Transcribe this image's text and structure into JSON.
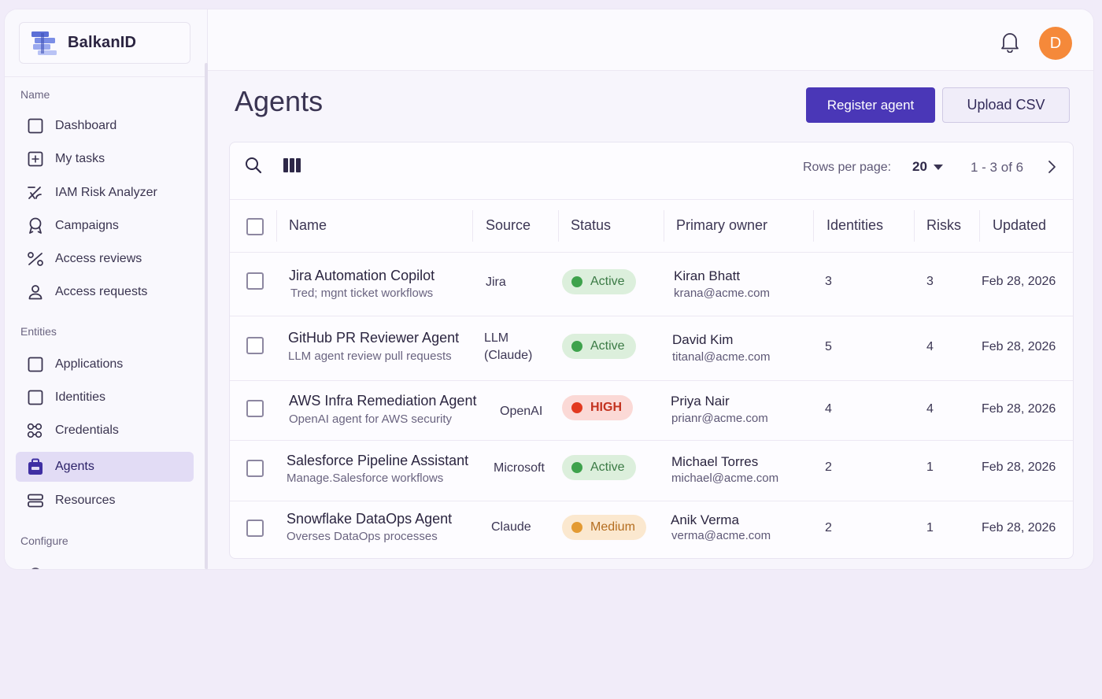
{
  "brand": {
    "name": "BalkanID"
  },
  "sidebar": {
    "section_name": "Name",
    "section_entities": "Entities",
    "section_configure": "Configure",
    "items": [
      {
        "label": "Dashboard",
        "icon": "square-icon"
      },
      {
        "label": "My tasks",
        "icon": "task-plus-icon"
      },
      {
        "label": "IAM Risk Analyzer",
        "icon": "risk-analyzer-icon"
      },
      {
        "label": "Campaigns",
        "icon": "campaign-ribbon-icon"
      },
      {
        "label": "Access reviews",
        "icon": "access-review-icon"
      },
      {
        "label": "Access requests",
        "icon": "user-icon"
      },
      {
        "label": "Applications",
        "icon": "square-icon"
      },
      {
        "label": "Identities",
        "icon": "square-icon"
      },
      {
        "label": "Credentials",
        "icon": "credentials-icon"
      },
      {
        "label": "Agents",
        "icon": "agent-briefcase-icon"
      },
      {
        "label": "Resources",
        "icon": "server-icon"
      }
    ],
    "active_item": "Agents"
  },
  "topbar": {
    "avatar_initial": "D"
  },
  "page": {
    "title": "Agents",
    "register_label": "Register agent",
    "upload_label": "Upload CSV"
  },
  "table": {
    "rows_per_page_label": "Rows per page:",
    "rows_per_page_value": "20",
    "pagination": "1 - 3 of 6",
    "columns": [
      "Name",
      "Source",
      "Status",
      "Primary owner",
      "Identities",
      "Risks",
      "Updated"
    ],
    "rows": [
      {
        "name": "Jira Automation Copilot",
        "desc": "Tred; mgnt ticket workflows",
        "source": "Jira",
        "status": "Active",
        "status_kind": "active",
        "owner": "Kiran Bhatt",
        "email": "krana@acme.com",
        "identities": "3",
        "risks": "3",
        "updated": "Feb 28, 2026"
      },
      {
        "name": "GitHub PR Reviewer Agent",
        "desc": "LLM agent review pull requests",
        "source": "LLM (Claude)",
        "status": "Active",
        "status_kind": "active",
        "owner": "David Kim",
        "email": "titanal@acme.com",
        "identities": "5",
        "risks": "4",
        "updated": "Feb 28, 2026"
      },
      {
        "name": "AWS Infra Remediation Agent",
        "desc": "OpenAI agent for AWS security",
        "source": "OpenAI",
        "status": "HIGH",
        "status_kind": "high",
        "owner": "Priya Nair",
        "email": "prianr@acme.com",
        "identities": "4",
        "risks": "4",
        "updated": "Feb 28, 2026"
      },
      {
        "name": "Salesforce Pipeline Assistant",
        "desc": "Manage.Salesforce workflows",
        "source": "Microsoft",
        "status": "Active",
        "status_kind": "active",
        "owner": "Michael Torres",
        "email": "michael@acme.com",
        "identities": "2",
        "risks": "1",
        "updated": "Feb 28, 2026"
      },
      {
        "name": "Snowflake DataOps Agent",
        "desc": "Overses DataOps processes",
        "source": "Claude",
        "status": "Medium",
        "status_kind": "medium",
        "owner": "Anik Verma",
        "email": "verma@acme.com",
        "identities": "2",
        "risks": "1",
        "updated": "Feb 28, 2026"
      }
    ]
  }
}
